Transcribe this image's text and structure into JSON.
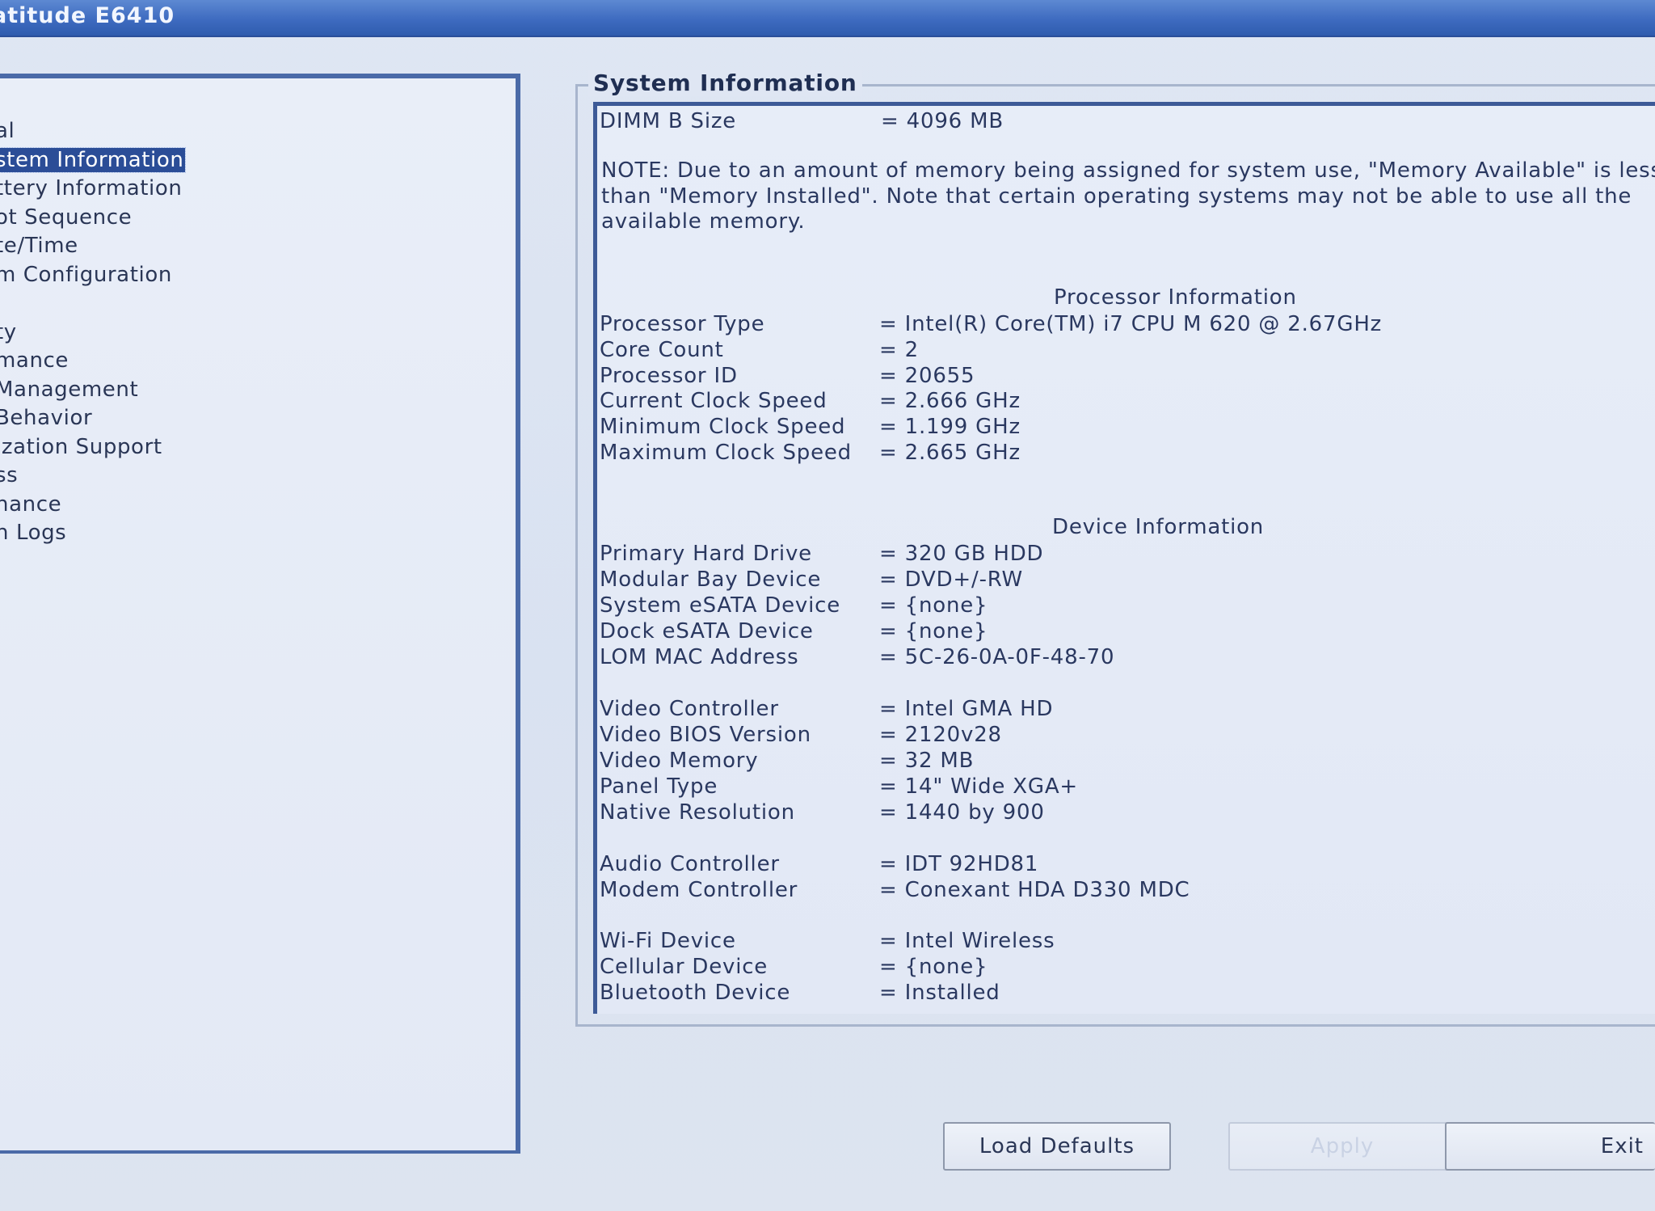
{
  "window": {
    "title": "atitude E6410"
  },
  "nav": {
    "items": [
      {
        "label": "al",
        "selected": false
      },
      {
        "label": "stem Information",
        "selected": true
      },
      {
        "label": "ttery Information",
        "selected": false
      },
      {
        "label": "ot Sequence",
        "selected": false
      },
      {
        "label": "te/Time",
        "selected": false
      },
      {
        "label": "m Configuration",
        "selected": false
      },
      {
        "label": "",
        "selected": false
      },
      {
        "label": "ty",
        "selected": false
      },
      {
        "label": "mance",
        "selected": false
      },
      {
        "label": " Management",
        "selected": false
      },
      {
        "label": " Behavior",
        "selected": false
      },
      {
        "label": "ization Support",
        "selected": false
      },
      {
        "label": "ss",
        "selected": false
      },
      {
        "label": "nance",
        "selected": false
      },
      {
        "label": "n Logs",
        "selected": false
      }
    ]
  },
  "system_info": {
    "group_title": "System Information",
    "memory": {
      "rows": [
        {
          "label": "DIMM B Size",
          "value": "= 4096 MB"
        }
      ],
      "note": "NOTE: Due to an amount of memory being assigned for system use, \"Memory Available\" is less\nthan \"Memory Installed\". Note that certain operating systems may not be able to use all the\navailable memory."
    },
    "processor": {
      "title": "Processor Information",
      "rows": [
        {
          "label": "Processor Type",
          "value": "= Intel(R) Core(TM) i7 CPU       M 620  @ 2.67GHz"
        },
        {
          "label": "Core Count",
          "value": "= 2"
        },
        {
          "label": "Processor ID",
          "value": "= 20655"
        },
        {
          "label": "Current Clock Speed",
          "value": "= 2.666 GHz"
        },
        {
          "label": "Minimum Clock Speed",
          "value": "= 1.199 GHz"
        },
        {
          "label": "Maximum Clock Speed",
          "value": "= 2.665 GHz"
        }
      ]
    },
    "device": {
      "title": "Device Information",
      "rows": [
        {
          "label": "Primary Hard Drive",
          "value": "= 320 GB HDD"
        },
        {
          "label": "Modular Bay Device",
          "value": "= DVD+/-RW"
        },
        {
          "label": "System eSATA Device",
          "value": "= {none}"
        },
        {
          "label": "Dock eSATA Device",
          "value": "= {none}"
        },
        {
          "label": "LOM MAC Address",
          "value": "= 5C-26-0A-0F-48-70"
        },
        {
          "label": "Video Controller",
          "value": "= Intel GMA HD"
        },
        {
          "label": "Video BIOS Version",
          "value": "= 2120v28"
        },
        {
          "label": "Video Memory",
          "value": "= 32 MB"
        },
        {
          "label": "Panel Type",
          "value": "= 14\" Wide XGA+"
        },
        {
          "label": "Native Resolution",
          "value": "= 1440 by 900"
        },
        {
          "label": "Audio Controller",
          "value": "= IDT 92HD81"
        },
        {
          "label": "Modem Controller",
          "value": "= Conexant HDA D330 MDC"
        },
        {
          "label": "Wi-Fi Device",
          "value": "= Intel Wireless"
        },
        {
          "label": "Cellular Device",
          "value": "= {none}"
        },
        {
          "label": "Bluetooth Device",
          "value": "= Installed"
        }
      ]
    }
  },
  "buttons": {
    "load_defaults": "Load Defaults",
    "apply": "Apply",
    "exit": "Exit"
  },
  "colors": {
    "title_bar": "#3e6bc0",
    "background": "#dfe6f3",
    "selection": "#2b4d97",
    "panel_border": "#4a6aa8",
    "text": "#2a3860"
  }
}
